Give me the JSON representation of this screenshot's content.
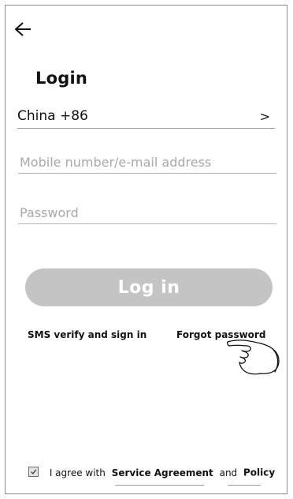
{
  "header": {
    "back_icon": "arrow-left-icon",
    "title": "Login"
  },
  "country": {
    "label": "China +86",
    "chevron": ">"
  },
  "form": {
    "account_placeholder": "Mobile number/e-mail address",
    "account_value": "",
    "password_placeholder": "Password",
    "password_value": "",
    "login_label": "Log in"
  },
  "links": {
    "sms_label": "SMS verify and sign in",
    "forgot_label": "Forgot password"
  },
  "pointer_icon": "pointing-hand-icon",
  "agreement": {
    "checked": true,
    "prefix": "I agree with",
    "service_label": "Service Agreement",
    "conjunction": "and",
    "policy_label": "Policy"
  },
  "colors": {
    "button_disabled": "#c4c4c4",
    "button_text": "#ffffff",
    "placeholder": "#a8a8a8",
    "frame_border": "#8a8a8a"
  }
}
